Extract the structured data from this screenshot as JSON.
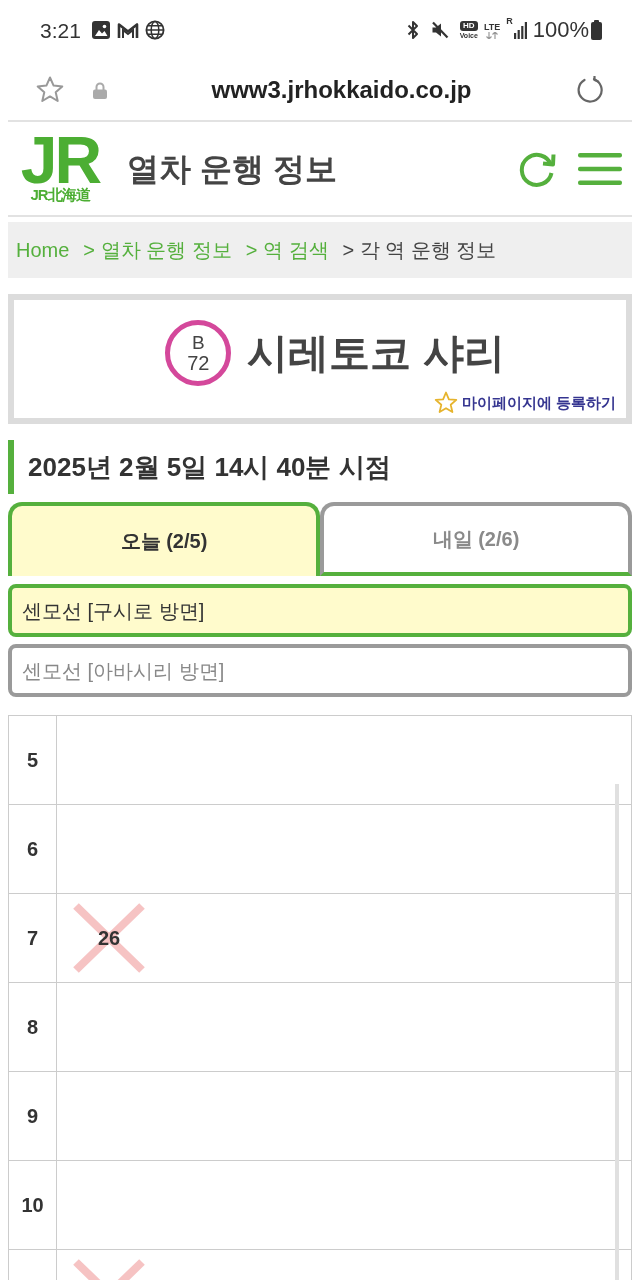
{
  "status_bar": {
    "time": "3:21",
    "hd_label": "HD",
    "voice_label": "Voice",
    "network": "LTE",
    "roaming": "R",
    "battery": "100%"
  },
  "address_bar": {
    "url": "www3.jrhokkaido.co.jp"
  },
  "header": {
    "logo_mark": "JR",
    "logo_caption": "JR北海道",
    "title": "열차 운행 정보"
  },
  "breadcrumb": [
    {
      "label": "Home",
      "current": false
    },
    {
      "label": "> 열차 운행 정보",
      "current": false
    },
    {
      "label": "> 역 검색",
      "current": false
    },
    {
      "label": "> 각 역 운행 정보",
      "current": true
    }
  ],
  "station": {
    "line_code": "B",
    "number": "72",
    "name": "시레토코 샤리",
    "register_link": "마이페이지에 등록하기"
  },
  "timestamp": "2025년 2월 5일 14시 40분 시점",
  "day_tabs": [
    {
      "label": "오늘 (2/5)",
      "selected": true
    },
    {
      "label": "내일 (2/6)",
      "selected": false
    }
  ],
  "directions": [
    {
      "label": "센모선 [구시로 방면]",
      "selected": true
    },
    {
      "label": "센모선 [아바시리 방면]",
      "selected": false
    }
  ],
  "timetable": {
    "rows": [
      {
        "hour": "5"
      },
      {
        "hour": "6"
      },
      {
        "hour": "7",
        "trains": [
          {
            "minute": "26",
            "cancelled": true
          }
        ]
      },
      {
        "hour": "8"
      },
      {
        "hour": "9"
      },
      {
        "hour": "10"
      },
      {
        "trains": [
          {
            "cancelled": true
          }
        ]
      }
    ]
  }
}
